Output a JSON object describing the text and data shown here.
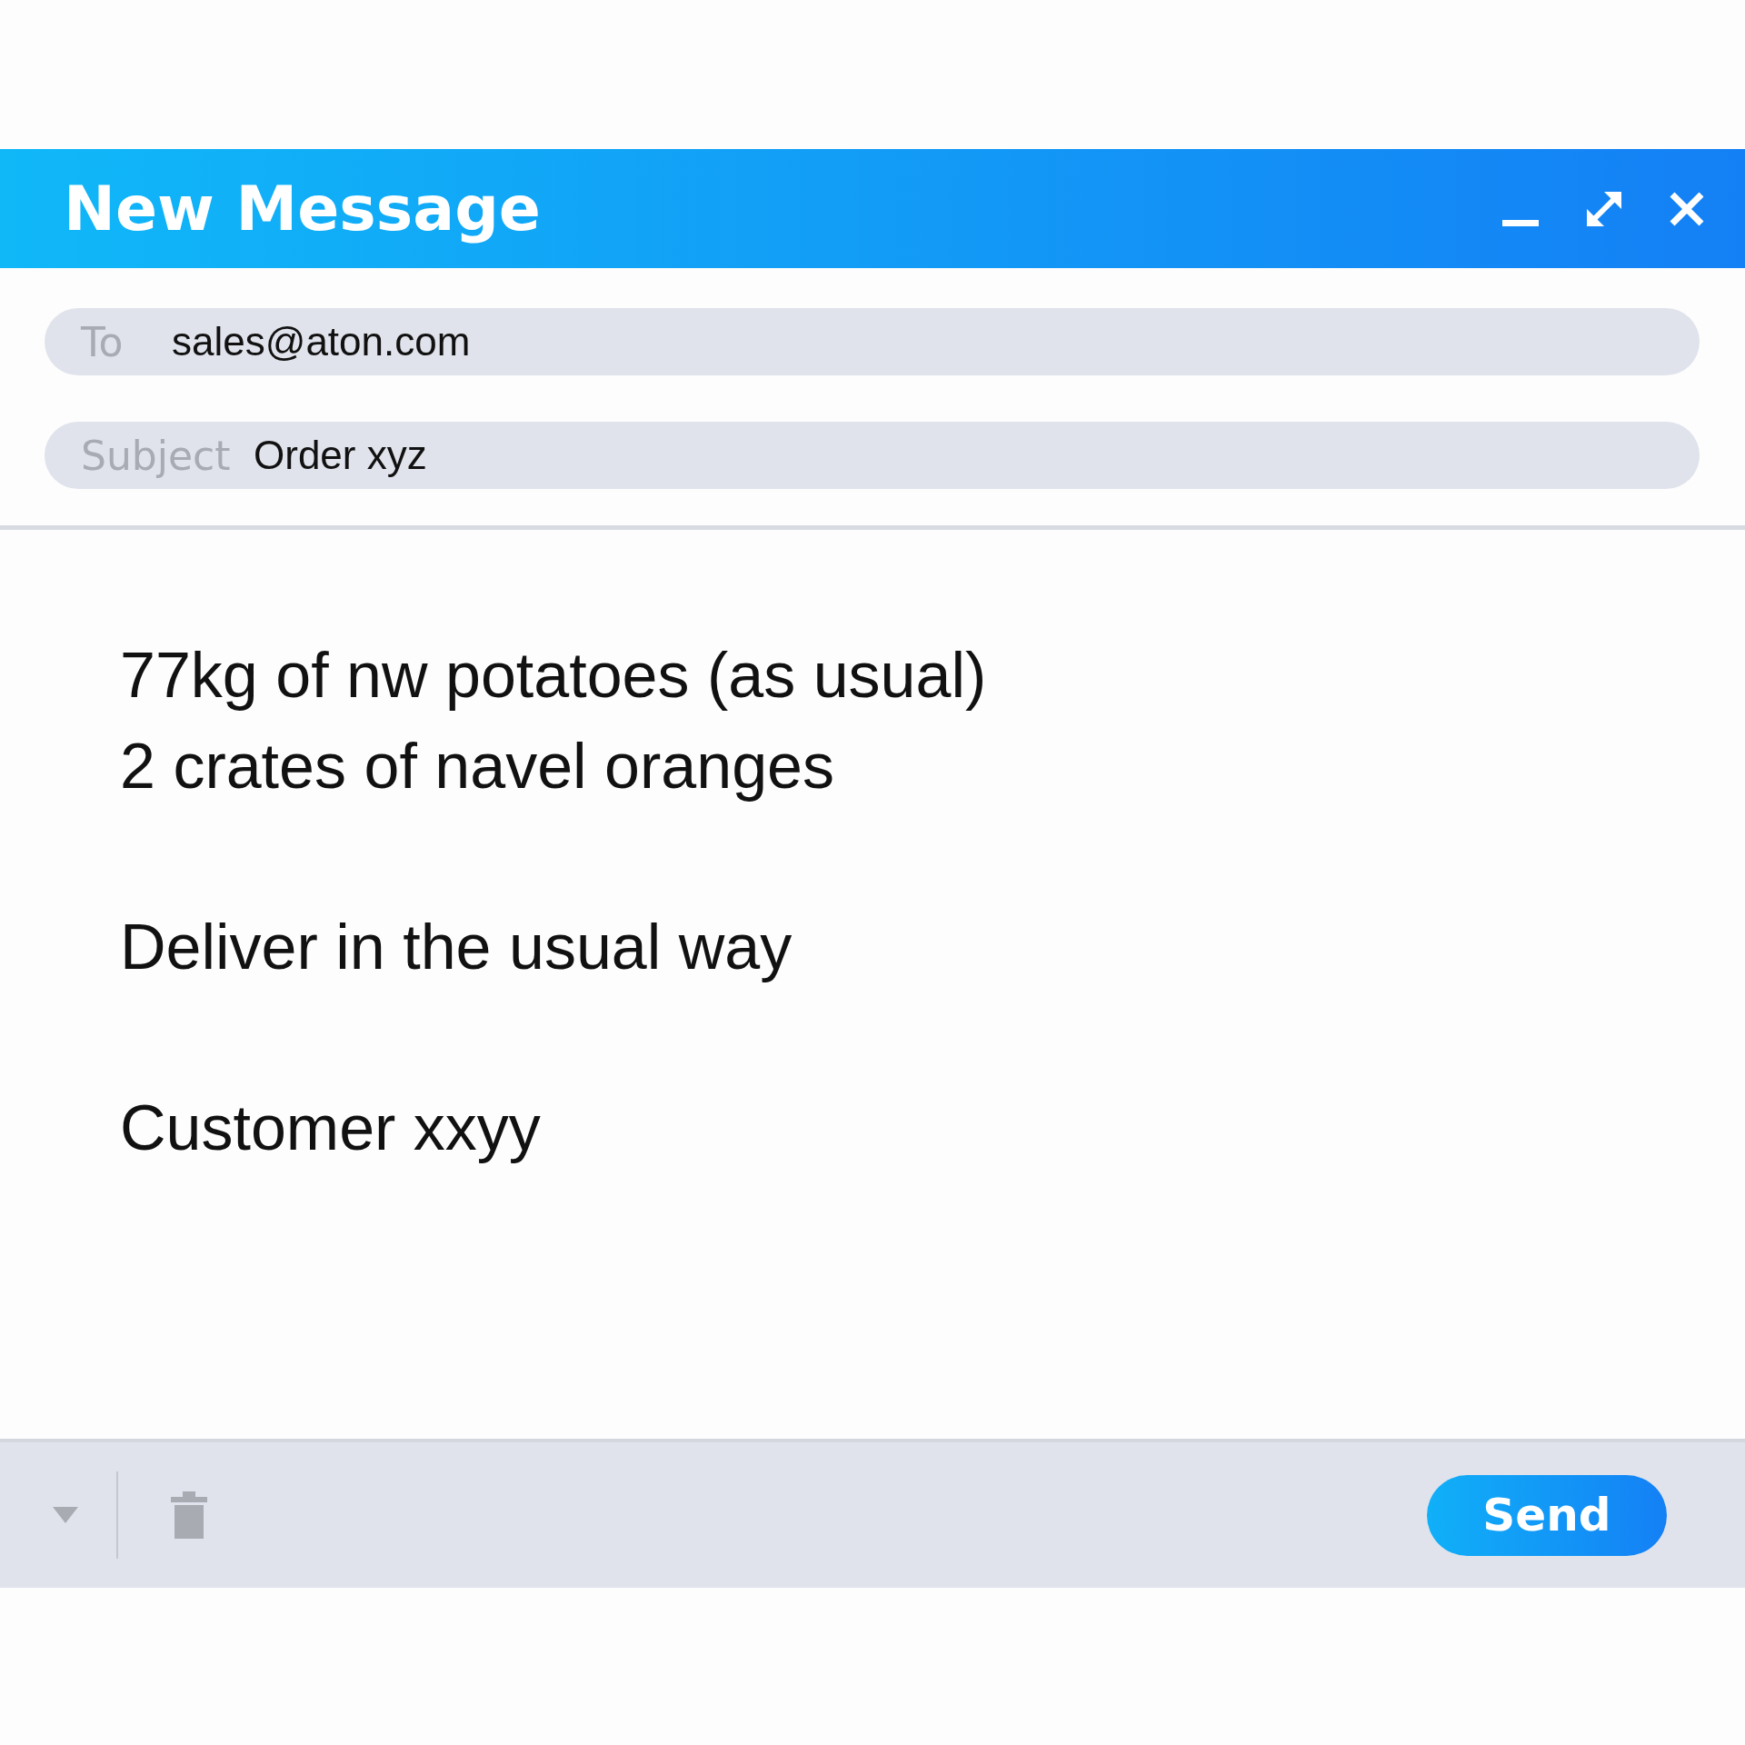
{
  "window": {
    "title": "New Message"
  },
  "fields": [
    {
      "label": "To",
      "value": "sales@aton.com"
    },
    {
      "label": "Subject",
      "value": "Order xyz"
    }
  ],
  "body": {
    "paragraphs": [
      [
        "77kg of nw potatoes (as usual)",
        "2 crates of navel oranges"
      ],
      [
        "Deliver in the usual way"
      ],
      [
        "Customer xxyy"
      ]
    ]
  },
  "footer": {
    "send_button": "Send"
  }
}
